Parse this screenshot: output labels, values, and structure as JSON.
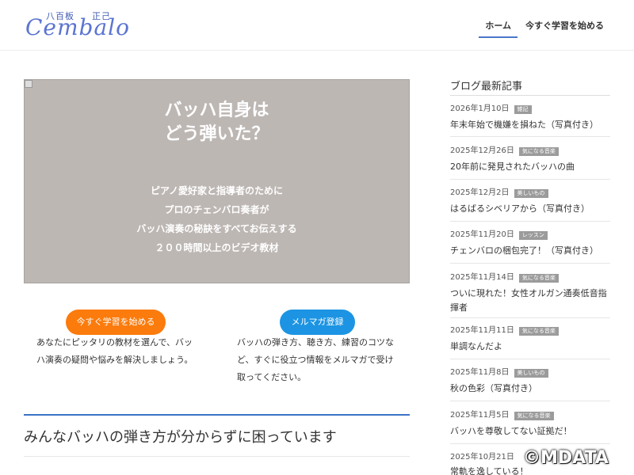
{
  "header": {
    "logo_kanji_left": "八百板",
    "logo_kanji_right": "正己",
    "logo_script": "Cembalo",
    "nav": [
      "ホーム",
      "今すぐ学習を始める"
    ]
  },
  "hero": {
    "title_line1": "バッハ自身は",
    "title_line2": "どう弾いた？",
    "sub": [
      "ピアノ愛好家と指導者のために",
      "プロのチェンバロ奏者が",
      "バッハ演奏の秘訣をすべてお伝えする",
      "２００時間以上のビデオ教材"
    ]
  },
  "cta": {
    "left_button": "今すぐ学習を始める",
    "left_text": "あなたにピッタリの教材を選んで、バッハ演奏の疑問や悩みを解決しましょう。",
    "right_button": "メルマガ登録",
    "right_text": "バッハの弾き方、聴き方、練習のコツなど、すぐに役立つ情報をメルマガで受け取ってください。"
  },
  "section": {
    "title": "みんなバッハの弾き方が分からずに困っています"
  },
  "sidebar": {
    "title": "ブログ最新記事",
    "posts": [
      {
        "date": "2026年1月10日",
        "tag": "雑記",
        "title": "年末年始で機嫌を損ねた（写真付き）"
      },
      {
        "date": "2025年12月26日",
        "tag": "気になる音楽",
        "title": "20年前に発見されたバッハの曲"
      },
      {
        "date": "2025年12月2日",
        "tag": "美しいもの",
        "title": "はるばるシベリアから（写真付き）"
      },
      {
        "date": "2025年11月20日",
        "tag": "レッスン",
        "title": "チェンバロの梱包完了！（写真付き）"
      },
      {
        "date": "2025年11月14日",
        "tag": "気になる音楽",
        "title": "ついに現れた！女性オルガン通奏低音指揮者"
      },
      {
        "date": "2025年11月11日",
        "tag": "気になる音楽",
        "title": "単調なんだよ"
      },
      {
        "date": "2025年11月8日",
        "tag": "美しいもの",
        "title": "秋の色彩（写真付き）"
      },
      {
        "date": "2025年11月5日",
        "tag": "気になる音楽",
        "title": "バッハを尊敬してない証拠だ！"
      },
      {
        "date": "2025年10月21日",
        "tag": "",
        "title": "常軌を逸している！"
      }
    ]
  },
  "watermark": "©MDATA"
}
